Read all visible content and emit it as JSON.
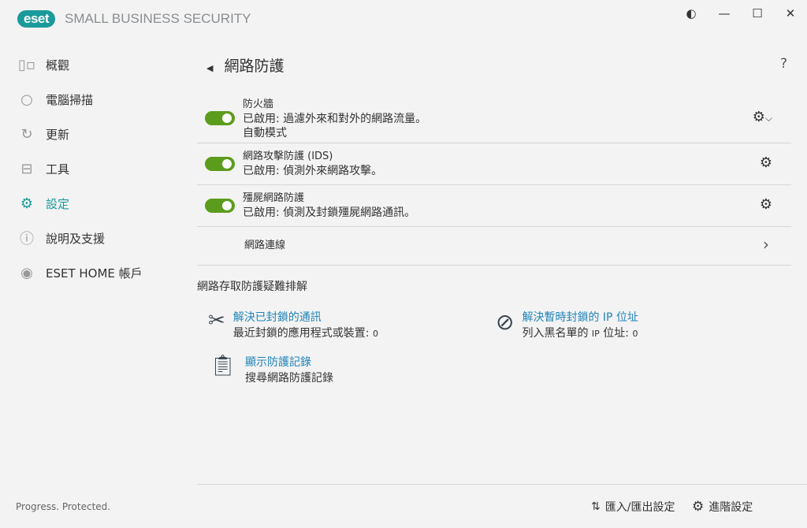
{
  "app": {
    "logo_text": "eset",
    "title": "SMALL BUSINESS SECURITY"
  },
  "window": {
    "contrast_icon": "contrast-icon",
    "minimize_icon": "minimize-icon",
    "maximize_icon": "maximize-icon",
    "close_icon": "close-icon"
  },
  "sidebar": {
    "items": [
      {
        "label": "概觀",
        "icon": "overview-icon"
      },
      {
        "label": "電腦掃描",
        "icon": "search-icon"
      },
      {
        "label": "更新",
        "icon": "refresh-icon"
      },
      {
        "label": "工具",
        "icon": "briefcase-icon"
      },
      {
        "label": "設定",
        "icon": "gear-icon",
        "active": true
      },
      {
        "label": "說明及支援",
        "icon": "help-icon"
      },
      {
        "label": "ESET HOME 帳戶",
        "icon": "account-icon"
      }
    ],
    "footer": "Progress. Protected."
  },
  "main": {
    "title": "網路防護",
    "help": "?",
    "rows": [
      {
        "name": "防火牆",
        "status": "已啟用: 過濾外來和對外的網路流量。",
        "extra": "自動模式",
        "enabled": true
      },
      {
        "name": "網路攻擊防護 (IDS)",
        "status": "已啟用: 偵測外來網路攻擊。",
        "enabled": true
      },
      {
        "name": "殭屍網路防護",
        "status": "已啟用: 偵測及封鎖殭屍網路通訊。",
        "enabled": true
      }
    ],
    "network_connections": "網路連線",
    "troubleshoot": {
      "heading": "網路存取防護疑難排解",
      "resolve_blocked": {
        "link": "解決已封鎖的通訊",
        "desc": "最近封鎖的應用程式或裝置:",
        "count": "0"
      },
      "resolve_ip": {
        "link": "解決暫時封鎖的 IP 位址",
        "desc": "列入黑名單的",
        "ip": "IP",
        "desc2": "位址:",
        "count": "0"
      },
      "show_log": {
        "link": "顯示防護記錄",
        "desc": "搜尋網路防護記錄"
      }
    }
  },
  "bottom": {
    "import_export": "匯入/匯出設定",
    "advanced": "進階設定"
  }
}
